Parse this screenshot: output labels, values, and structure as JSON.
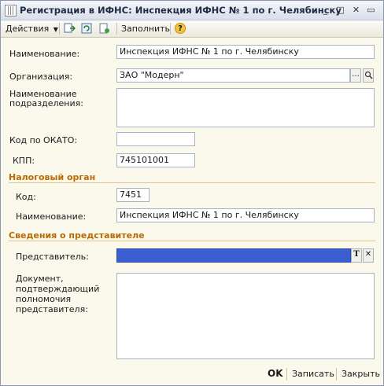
{
  "window": {
    "title": "Регистрация в ИФНС: Инспекция ИФНС № 1 по г. Челябинску"
  },
  "toolbar": {
    "actions_label": "Действия",
    "fill_label": "Заполнить",
    "help_label": "?"
  },
  "form": {
    "name_label": "Наименование:",
    "name_value": "Инспекция ИФНС № 1 по г. Челябинску",
    "org_label": "Организация:",
    "org_value": "ЗАО \"Модерн\"",
    "org_select": "...",
    "subdivision_label_1": "Наименование",
    "subdivision_label_2": "подразделения:",
    "subdivision_value": "",
    "okato_label": "Код по ОКАТО:",
    "okato_value": "",
    "kpp_label": "КПП:",
    "kpp_value": "745101001"
  },
  "tax_authority": {
    "section_title": "Налоговый орган",
    "code_label": "Код:",
    "code_value": "7451",
    "name_label": "Наименование:",
    "name_value": "Инспекция ИФНС № 1 по г. Челябинску"
  },
  "representative": {
    "section_title": "Сведения о представителе",
    "rep_label": "Представитель:",
    "rep_value": "",
    "type_btn": "T",
    "clear_btn": "✕",
    "doc_label_1": "Документ,",
    "doc_label_2": "подтверждающий",
    "doc_label_3": "полномочия",
    "doc_label_4": "представителя:",
    "doc_value": ""
  },
  "footer": {
    "ok_label": "OK",
    "save_label": "Записать",
    "close_label": "Закрыть"
  },
  "colors": {
    "section_heading": "#b96a00",
    "selected_field": "#3b5fd0",
    "form_bg": "#fbf8ec"
  }
}
